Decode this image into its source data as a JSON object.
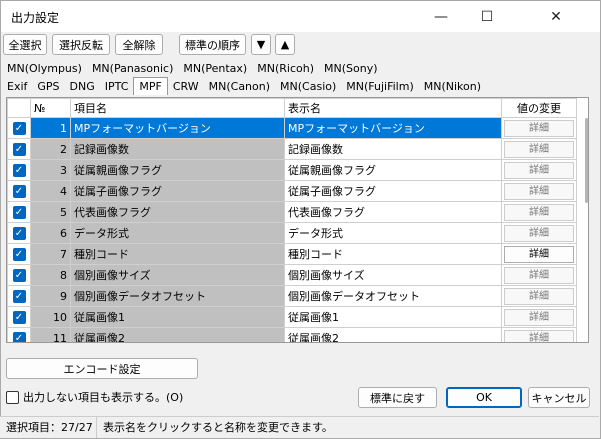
{
  "window": {
    "title": "出力設定",
    "minimize": "—",
    "maximize": "☐",
    "close": "✕"
  },
  "toolbar": {
    "select_all": "全選択",
    "invert": "選択反転",
    "clear_all": "全解除",
    "standard_order": "標準の順序",
    "move_down": "▼",
    "move_up": "▲"
  },
  "tabs_row1": [
    "MN(Olympus)",
    "MN(Panasonic)",
    "MN(Pentax)",
    "MN(Ricoh)",
    "MN(Sony)"
  ],
  "tabs_row2": [
    "Exif",
    "GPS",
    "DNG",
    "IPTC",
    "MPF",
    "CRW",
    "MN(Canon)",
    "MN(Casio)",
    "MN(FujiFilm)",
    "MN(Nikon)"
  ],
  "active_tab": "MPF",
  "columns": {
    "no": "№",
    "item": "項目名",
    "display": "表示名",
    "change": "値の変更"
  },
  "rows": [
    {
      "no": "1",
      "item": "MPフォーマットバージョン",
      "display": "MPフォーマットバージョン",
      "detail": "詳細",
      "checked": true,
      "selected": true,
      "enabled": false
    },
    {
      "no": "2",
      "item": "記録画像数",
      "display": "記録画像数",
      "detail": "詳細",
      "checked": true,
      "selected": false,
      "enabled": false
    },
    {
      "no": "3",
      "item": "従属親画像フラグ",
      "display": "従属親画像フラグ",
      "detail": "詳細",
      "checked": true,
      "selected": false,
      "enabled": false
    },
    {
      "no": "4",
      "item": "従属子画像フラグ",
      "display": "従属子画像フラグ",
      "detail": "詳細",
      "checked": true,
      "selected": false,
      "enabled": false
    },
    {
      "no": "5",
      "item": "代表画像フラグ",
      "display": "代表画像フラグ",
      "detail": "詳細",
      "checked": true,
      "selected": false,
      "enabled": false
    },
    {
      "no": "6",
      "item": "データ形式",
      "display": "データ形式",
      "detail": "詳細",
      "checked": true,
      "selected": false,
      "enabled": false
    },
    {
      "no": "7",
      "item": "種別コード",
      "display": "種別コード",
      "detail": "詳細",
      "checked": true,
      "selected": false,
      "enabled": true
    },
    {
      "no": "8",
      "item": "個別画像サイズ",
      "display": "個別画像サイズ",
      "detail": "詳細",
      "checked": true,
      "selected": false,
      "enabled": false
    },
    {
      "no": "9",
      "item": "個別画像データオフセット",
      "display": "個別画像データオフセット",
      "detail": "詳細",
      "checked": true,
      "selected": false,
      "enabled": false
    },
    {
      "no": "10",
      "item": "従属画像1",
      "display": "従属画像1",
      "detail": "詳細",
      "checked": true,
      "selected": false,
      "enabled": false
    },
    {
      "no": "11",
      "item": "従属画像2",
      "display": "従属画像2",
      "detail": "詳細",
      "checked": true,
      "selected": false,
      "enabled": false
    }
  ],
  "encode_button": "エンコード設定",
  "show_hidden_label": "出力しない項目も表示する。(O)",
  "buttons": {
    "reset": "標準に戻す",
    "ok": "OK",
    "cancel": "キャンセル"
  },
  "status": {
    "selected": "選択項目：27/27",
    "hint": "表示名をクリックすると名称を変更できます。"
  },
  "colors": {
    "selection": "#0078d7",
    "checkbox": "#0067c0",
    "disabled_cell": "#c0c0c0"
  }
}
